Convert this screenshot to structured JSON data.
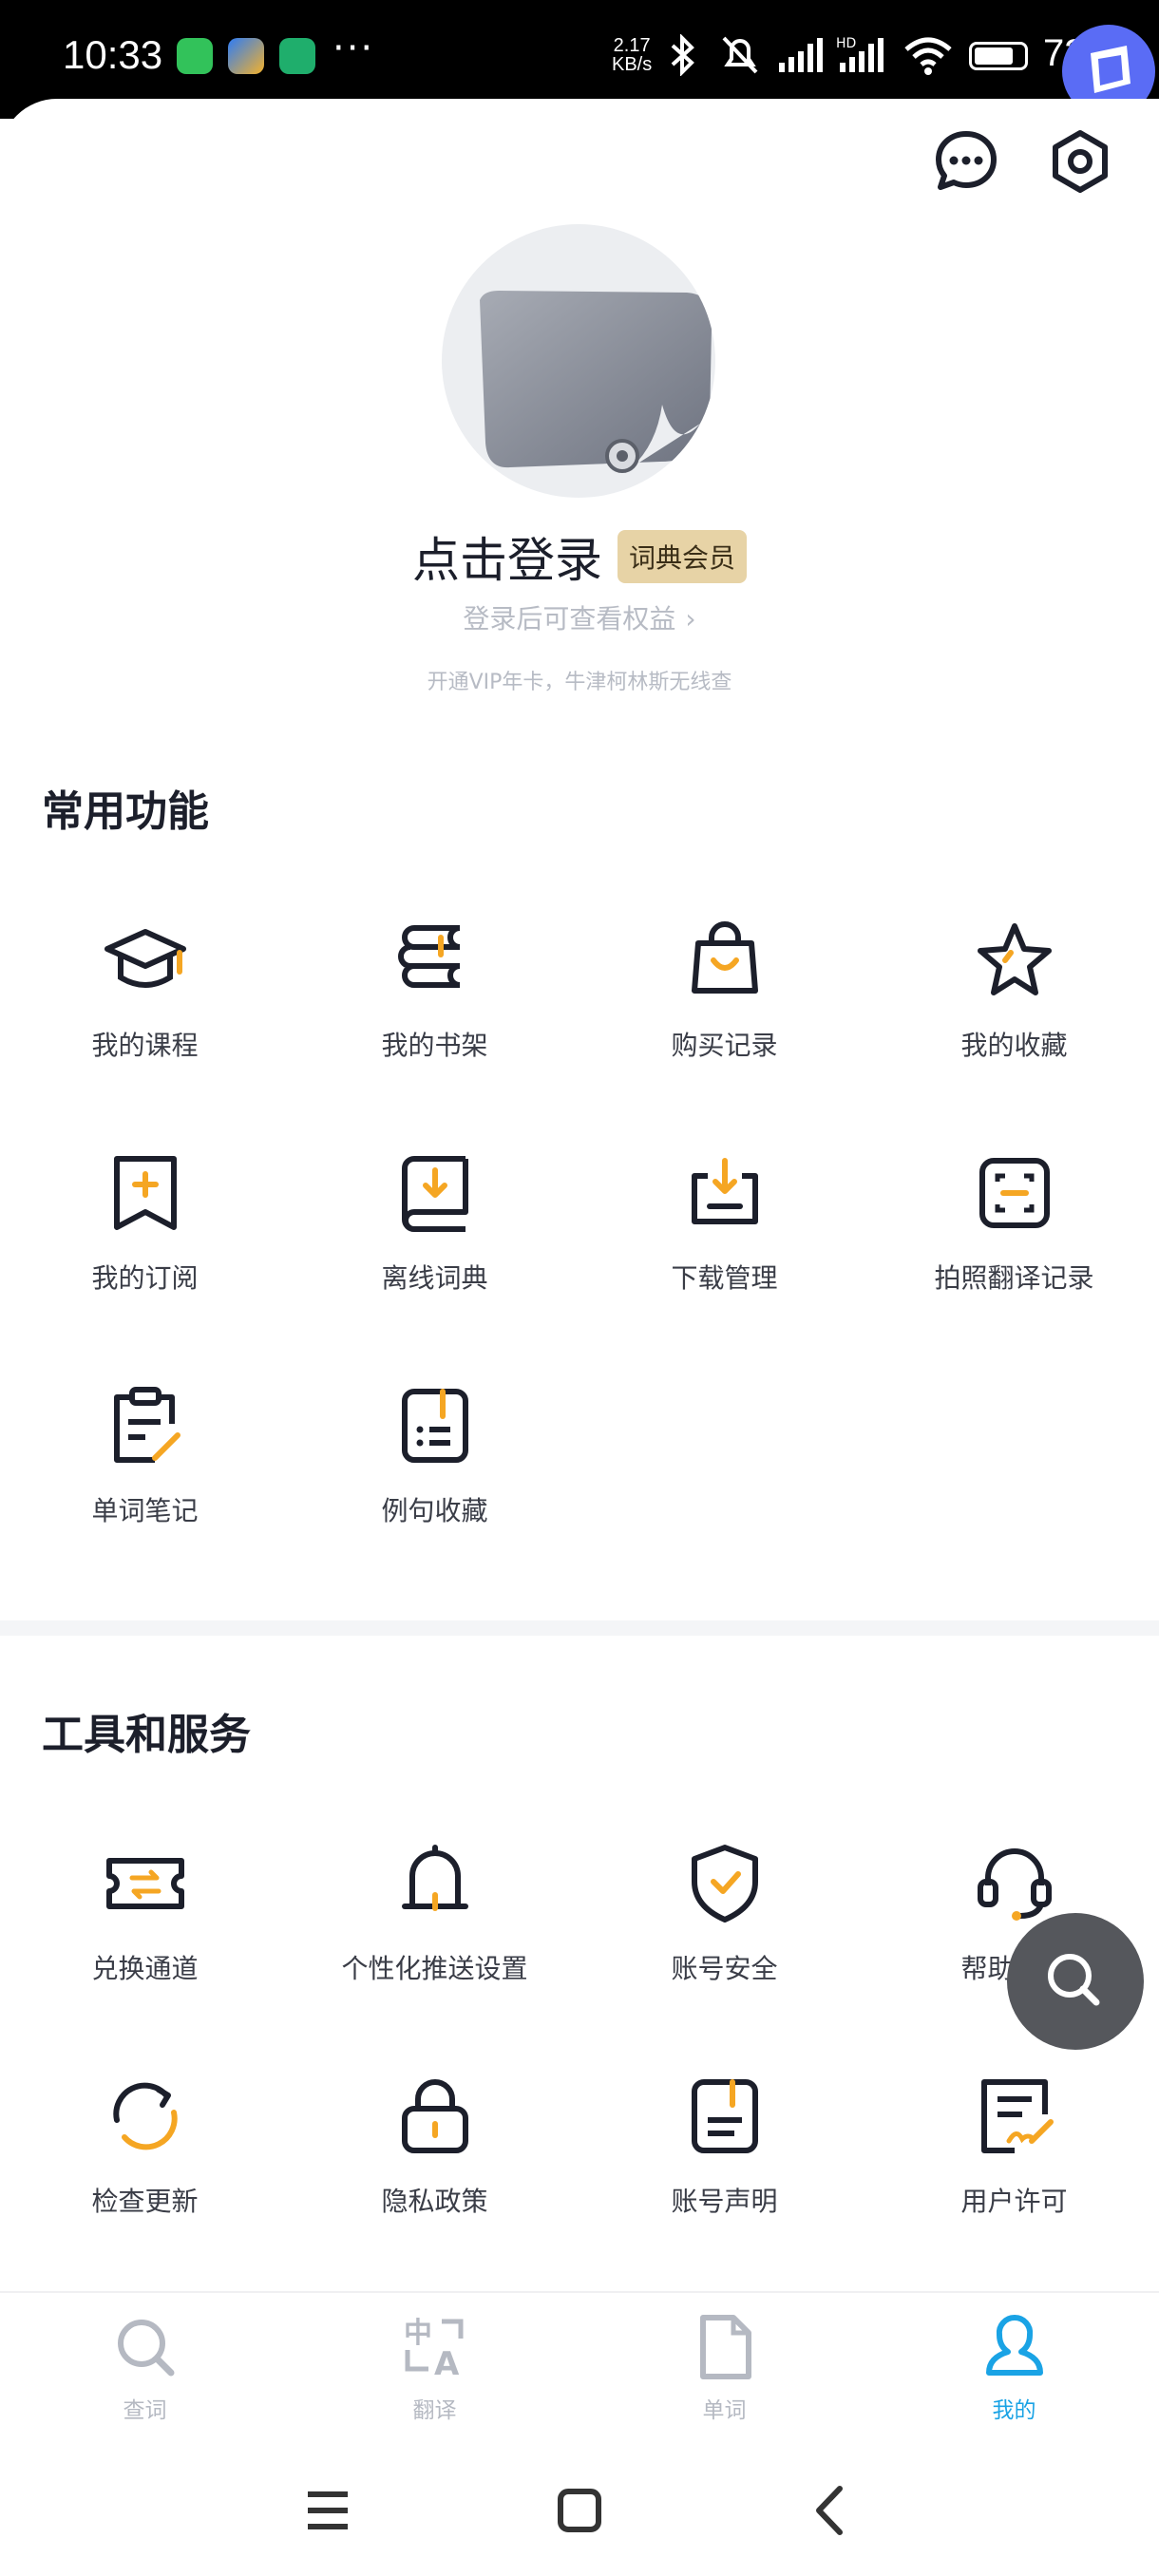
{
  "status_bar": {
    "time": "10:33",
    "dots": "···",
    "net_speed_value": "2.17",
    "net_speed_unit": "KB/s",
    "battery_level": "73"
  },
  "header": {
    "message_icon": "chat-bubble-icon",
    "settings_icon": "gear-icon"
  },
  "profile": {
    "login_title": "点击登录",
    "vip_badge": "词典会员",
    "login_subtitle": "登录后可查看权益",
    "promo": "开通VIP年卡，牛津柯林斯无线查"
  },
  "common_section": {
    "title": "常用功能",
    "items": [
      {
        "label": "我的课程",
        "icon": "graduation-cap-icon"
      },
      {
        "label": "我的书架",
        "icon": "bookshelf-icon"
      },
      {
        "label": "购买记录",
        "icon": "shopping-bag-icon"
      },
      {
        "label": "我的收藏",
        "icon": "star-icon"
      },
      {
        "label": "我的订阅",
        "icon": "bookmark-plus-icon"
      },
      {
        "label": "离线词典",
        "icon": "book-download-icon"
      },
      {
        "label": "下载管理",
        "icon": "tray-download-icon"
      },
      {
        "label": "拍照翻译记录",
        "icon": "scan-frame-icon"
      },
      {
        "label": "单词笔记",
        "icon": "clipboard-pen-icon"
      },
      {
        "label": "例句收藏",
        "icon": "document-list-icon"
      }
    ]
  },
  "tools_section": {
    "title": "工具和服务",
    "items": [
      {
        "label": "兑换通道",
        "icon": "exchange-ticket-icon"
      },
      {
        "label": "个性化推送设置",
        "icon": "bell-icon"
      },
      {
        "label": "账号安全",
        "icon": "shield-check-icon"
      },
      {
        "label": "帮助反馈",
        "icon": "headset-icon"
      },
      {
        "label": "检查更新",
        "icon": "refresh-icon"
      },
      {
        "label": "隐私政策",
        "icon": "lock-icon"
      },
      {
        "label": "账号声明",
        "icon": "document-icon"
      },
      {
        "label": "用户许可",
        "icon": "signed-document-icon"
      }
    ]
  },
  "tabs": [
    {
      "label": "查词",
      "icon": "search-icon",
      "active": false
    },
    {
      "label": "翻译",
      "icon": "translate-icon",
      "active": false
    },
    {
      "label": "单词",
      "icon": "file-icon",
      "active": false
    },
    {
      "label": "我的",
      "icon": "person-icon",
      "active": true
    }
  ],
  "colors": {
    "accent": "#f5a623",
    "ink": "#1c1f2b",
    "active_tab": "#1aa3e5",
    "vip_badge_bg": "#e7d3a6"
  }
}
